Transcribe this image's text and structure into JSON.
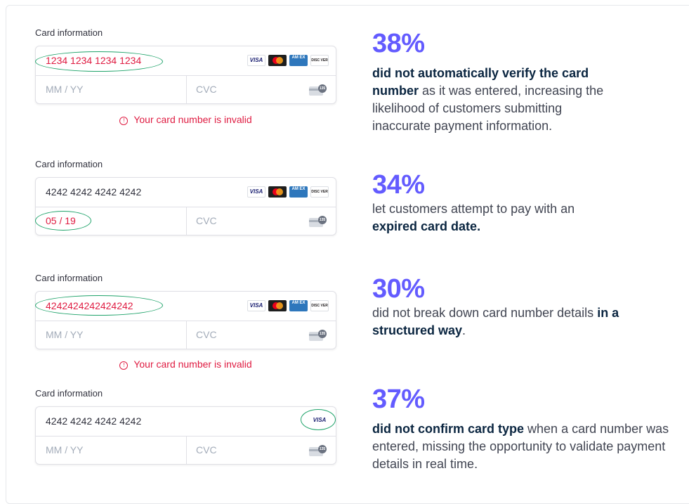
{
  "demos": [
    {
      "label": "Card information",
      "number": "1234 1234 1234 1234",
      "expiry": "",
      "expiry_placeholder": "MM / YY",
      "cvc_placeholder": "CVC",
      "error": "Your card number is invalid"
    },
    {
      "label": "Card information",
      "number": "4242 4242 4242 4242",
      "expiry": "05 / 19",
      "cvc_placeholder": "CVC"
    },
    {
      "label": "Card information",
      "number": "4242424242424242",
      "expiry_placeholder": "MM / YY",
      "cvc_placeholder": "CVC",
      "error": "Your card number is invalid"
    },
    {
      "label": "Card information",
      "number": "4242 4242 4242 4242",
      "expiry_placeholder": "MM / YY",
      "cvc_placeholder": "CVC"
    }
  ],
  "brands": {
    "visa": "VISA",
    "amex": "AM EX",
    "discover": "DISC VER",
    "cvc_badge": "135"
  },
  "stats": [
    {
      "percent": "38%",
      "bold": "did not automatically verify the card number",
      "text": " as it was entered, increasing the likelihood of customers submitting inaccurate payment information."
    },
    {
      "percent": "34%",
      "text": "let customers attempt to pay with an ",
      "bold": "expired card date."
    },
    {
      "percent": "30%",
      "text": "did not break down card number details ",
      "bold": "in a structured way",
      "tail": "."
    },
    {
      "percent": "37%",
      "bold": "did not confirm card type",
      "text": " when a card number was entered, missing the opportunity to validate payment details in real time."
    }
  ],
  "colors": {
    "accent": "#635bff",
    "error": "#df1b41",
    "annotation": "#1fa36a"
  }
}
